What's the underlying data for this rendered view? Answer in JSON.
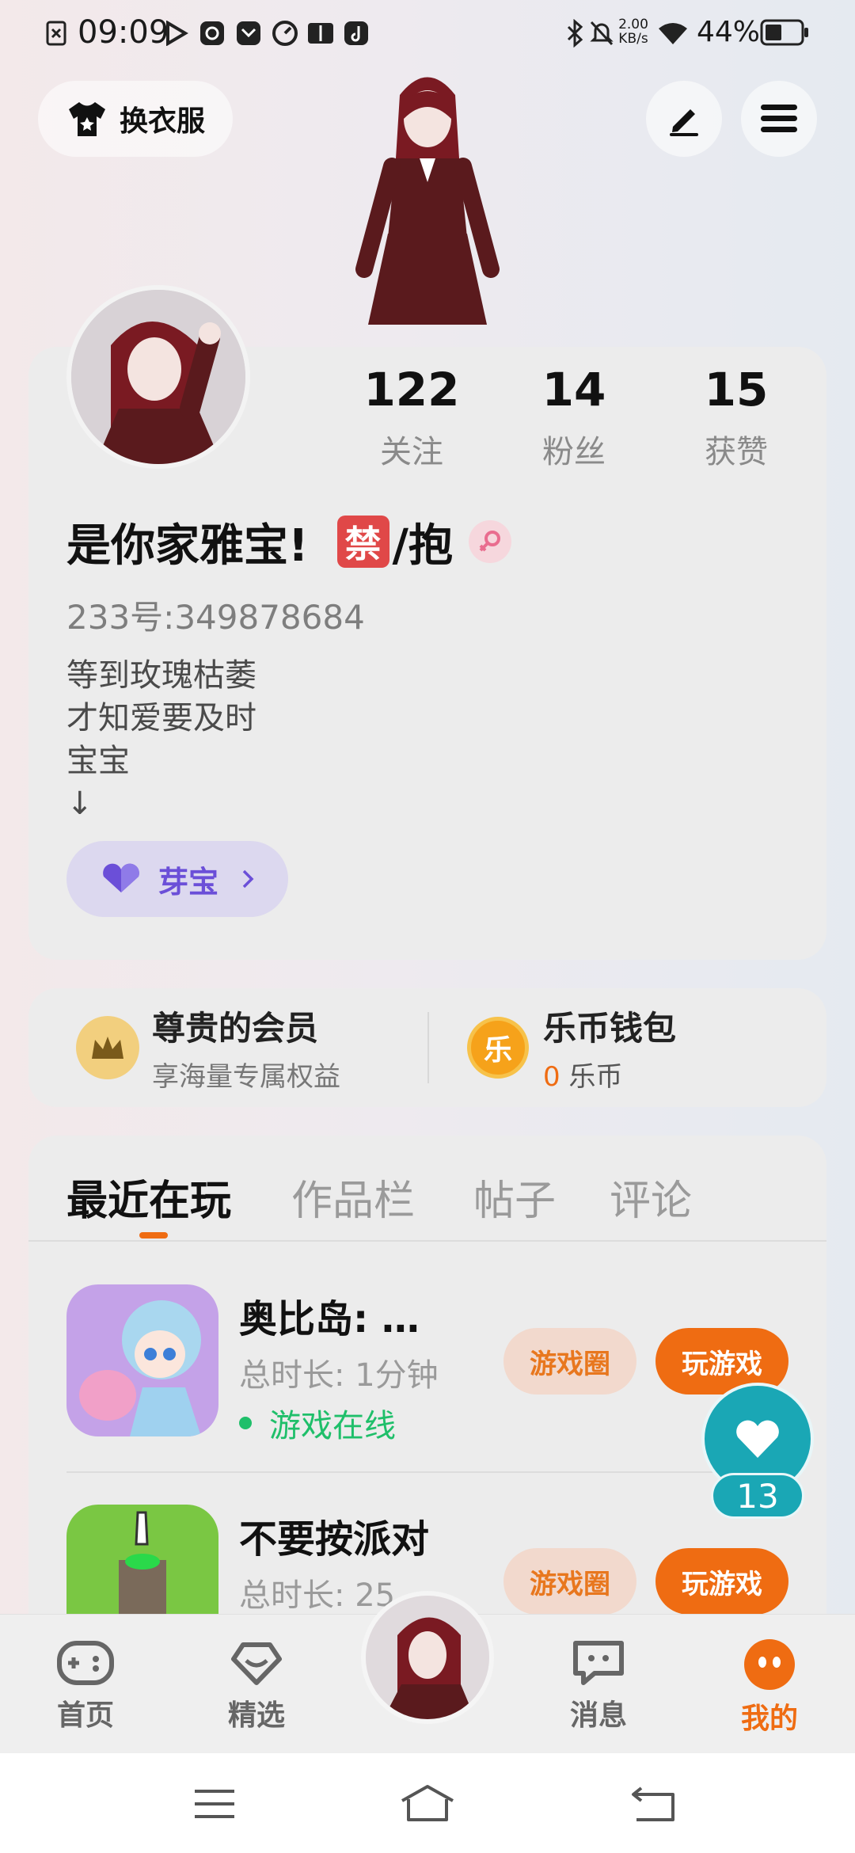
{
  "status_bar": {
    "time": "09:09",
    "net_speed": "2.00",
    "net_unit": "KB/s",
    "battery": "44%"
  },
  "top": {
    "dress_label": "换衣服"
  },
  "profile": {
    "stats": [
      {
        "num": "122",
        "label": "关注"
      },
      {
        "num": "14",
        "label": "粉丝"
      },
      {
        "num": "15",
        "label": "获赞"
      }
    ],
    "name": "是你家雅宝!",
    "name_badge": "禁",
    "name_suffix": "/抱",
    "id_text": "233号:349878684",
    "bio": [
      "等到玫瑰枯萎",
      "才知爱要及时",
      "宝宝",
      "↓"
    ],
    "tag_label": "芽宝"
  },
  "wallet": {
    "vip_title": "尊贵的会员",
    "vip_sub": "享海量专属权益",
    "coin_icon_text": "乐",
    "coin_title": "乐币钱包",
    "coin_amount": "0",
    "coin_unit": "乐币"
  },
  "tabs": [
    "最近在玩",
    "作品栏",
    "帖子",
    "评论"
  ],
  "games": [
    {
      "title": "奥比岛: …",
      "duration": "总时长: 1分钟",
      "status": "游戏在线",
      "circle": "游戏圈",
      "play": "玩游戏"
    },
    {
      "title": "不要按派对",
      "duration": "总时长: 25",
      "circle": "游戏圈",
      "play": "玩游戏"
    }
  ],
  "float_like": {
    "count": "13"
  },
  "bottom_nav": [
    {
      "label": "首页"
    },
    {
      "label": "精选"
    },
    {
      "label": "消息"
    },
    {
      "label": "我的"
    }
  ],
  "colors": {
    "accent": "#ef6c12",
    "online": "#1fbf6a",
    "teal": "#1aa7b5",
    "purple": "#6b4fd8"
  }
}
